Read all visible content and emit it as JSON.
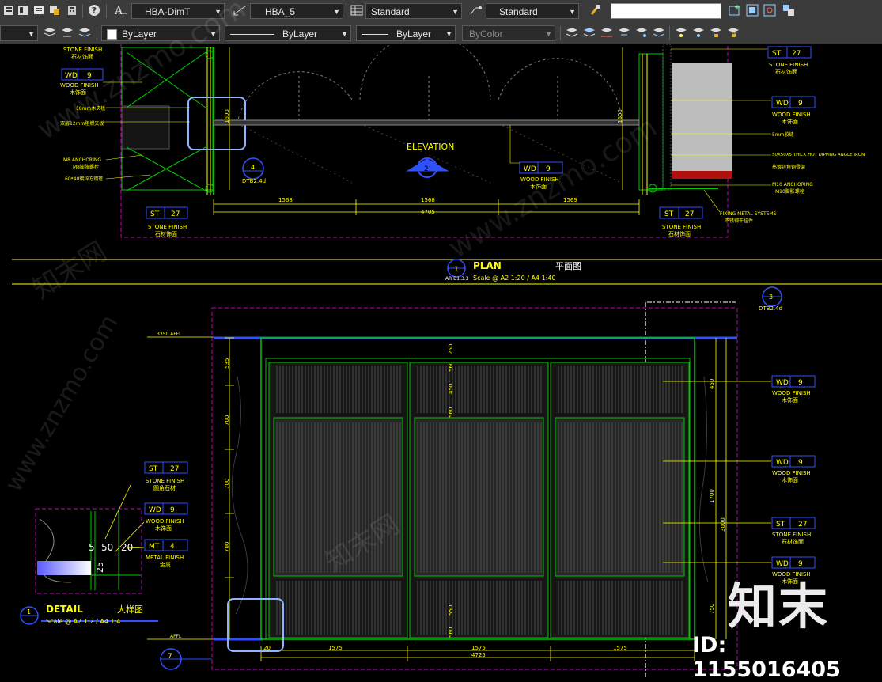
{
  "toolbar1": {
    "dim_style": "HBA-DimT",
    "multileader_style": "HBA_5",
    "table_style": "Standard",
    "text_style": "Standard",
    "search_value": ""
  },
  "toolbar2": {
    "color": "ByLayer",
    "linetype": "ByLayer",
    "lineweight": "ByLayer",
    "plot_style": "ByColor"
  },
  "colors": {
    "toolbar_bg": "#3b3b3b",
    "canvas_bg": "#000000",
    "yellow": "#ffff00",
    "green": "#00c800",
    "blue": "#3050ff",
    "magenta": "#c000c0",
    "highlight": "#8fb4ff"
  },
  "elevation_view": {
    "left_tags": [
      {
        "label": "STONE FINISH",
        "cn": "石材饰面"
      },
      {
        "code": "WD",
        "num": "9",
        "label": "WOOD FINISH",
        "cn": "木饰面"
      },
      {
        "note": "18mm木夹板"
      },
      {
        "note": "双层12mm阻燃夹板"
      },
      {
        "note": "M8 ANCHORING",
        "cn": "M8膨胀螺栓"
      },
      {
        "note": "60*40镀锌方钢管"
      }
    ],
    "right_tags": [
      {
        "code": "ST",
        "num": "27",
        "label": "STONE FINISH",
        "cn": "石材饰面"
      },
      {
        "code": "WD",
        "num": "9",
        "label": "WOOD FINISH",
        "cn": "木饰面"
      },
      {
        "note": "5mm胶缝"
      },
      {
        "note": "50X50X5 THICK HOT DIPPING ANGLE IRON",
        "cn": "热镀锌角钢骨架"
      },
      {
        "note": "M10 ANCHORING",
        "cn": "M10膨胀螺栓"
      },
      {
        "note": "FIXING METAL SYSTEMS",
        "cn": "不锈钢干挂件"
      }
    ],
    "bottom_left_tag": {
      "code": "ST",
      "num": "27",
      "label": "STONE FINISH",
      "cn": "石材饰面"
    },
    "bottom_right_tag": {
      "code": "ST",
      "num": "27",
      "label": "STONE FINISH",
      "cn": "石材饰面"
    },
    "center_tag": {
      "code": "WD",
      "num": "9",
      "label": "WOOD FINISH",
      "cn": "木饰面"
    },
    "section_ref": {
      "num": "4",
      "sheet": "DTB2.4d"
    },
    "elevation_title": "ELEVATION",
    "elevation_marker": "2",
    "dim_vertical": "1600",
    "dims": [
      "1568",
      "1568",
      "1569"
    ],
    "dim_total": "4705"
  },
  "plan_title": {
    "title": "PLAN",
    "cn": "平面图",
    "scale": "Scale @ A2 1:20 / A4 1:40",
    "sheet_ref": "AR B1.3.3",
    "marker": "1"
  },
  "plan_view": {
    "ref_marker": {
      "num": "3",
      "sheet": "DTB2.4d"
    },
    "level_top": "3350 AFFL",
    "level_bottom": "AFFL",
    "left_dims": [
      "535",
      "700",
      "700",
      "700"
    ],
    "panel_dims": [
      "250",
      "560",
      "450",
      "560",
      "550",
      "560"
    ],
    "right_dims": [
      "450",
      "1700",
      "3000",
      "750"
    ],
    "right_tags": [
      {
        "code": "WD",
        "num": "9",
        "label": "WOOD FINISH",
        "cn": "木饰面"
      },
      {
        "code": "WD",
        "num": "9",
        "label": "WOOD FINISH",
        "cn": "木饰面"
      },
      {
        "code": "ST",
        "num": "27",
        "label": "STONE FINISH",
        "cn": "石材饰面"
      },
      {
        "code": "WD",
        "num": "9",
        "label": "WOOD FINISH",
        "cn": "木饰面"
      }
    ],
    "bottom_dims": [
      "1575",
      "1575",
      "1575"
    ],
    "bottom_total": "4725",
    "bottom_small_dim": "20"
  },
  "detail": {
    "tags": [
      {
        "code": "ST",
        "num": "27",
        "label": "STONE FINISH",
        "cn": "圆角石材"
      },
      {
        "code": "WD",
        "num": "9",
        "label": "WOOD FINISH",
        "cn": "木饰面"
      },
      {
        "code": "MT",
        "num": "4",
        "label": "METAL FINISH",
        "cn": "金属"
      }
    ],
    "dims": [
      "5",
      "50",
      "20",
      "25"
    ],
    "title": "DETAIL",
    "cn": "大样图",
    "scale": "Scale @ A2 1:2 / A4 1:4",
    "marker": "1",
    "bottom_marker": "7"
  },
  "watermark": {
    "brand_cn": "知末",
    "id_text": "ID: 1155016405",
    "site": "www.znzmo.com",
    "site_cn": "知末网"
  }
}
